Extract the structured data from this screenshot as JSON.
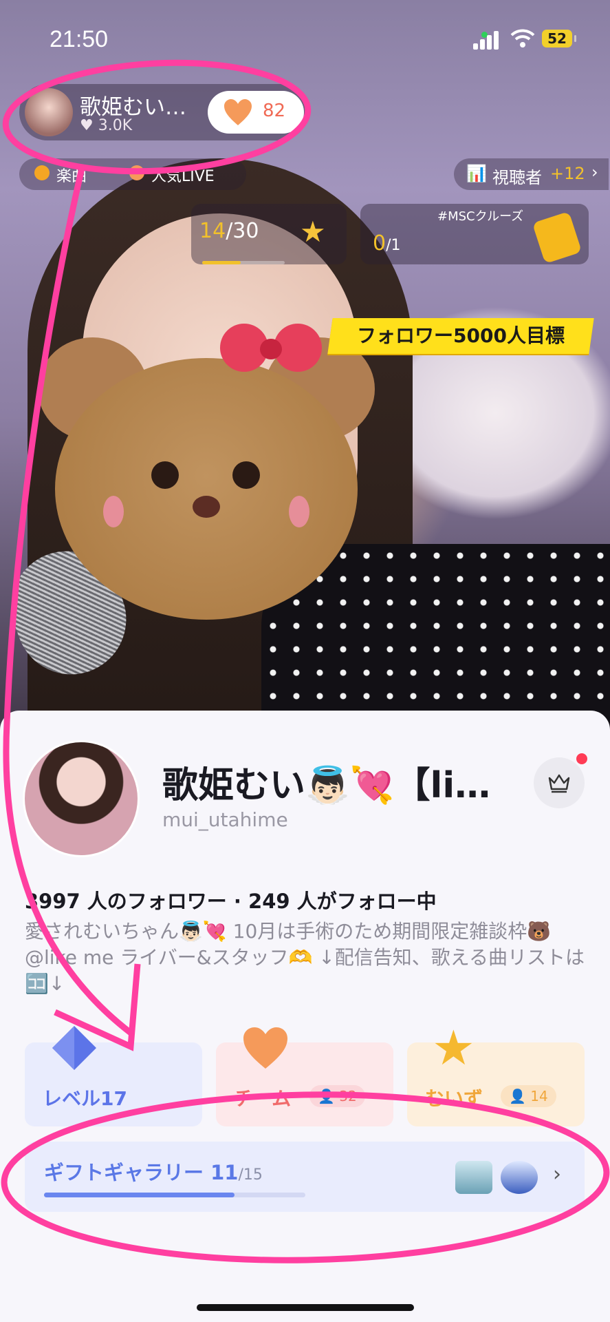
{
  "status_bar": {
    "time": "21:50",
    "battery": "52"
  },
  "stream": {
    "host_name": "歌姫むい…",
    "host_likes": "3.0K",
    "like_count": "82",
    "tag1": "楽曲",
    "tag2": "人気LIVE",
    "viewers_label": "視聴者",
    "viewers_delta": "+12",
    "progress1": {
      "current": "14",
      "total": "/30",
      "fraction": 0.47
    },
    "progress2": {
      "current": "0",
      "total": "/1",
      "tag": "#MSCクルーズ"
    },
    "banner": "フォロワー5000人目標"
  },
  "profile": {
    "name": "歌姫むい👼🏻💘【li…",
    "handle": "mui_utahime",
    "follow_info": "3997 人のフォロワー · 249 人がフォロー中",
    "bio": "愛されむいちゃん👼🏻💘 10月は手術のため期間限定雑談枠🐻 @like me ライバー&スタッフ🫶 ↓配信告知、歌える曲リストは🈁↓",
    "cards": [
      {
        "label": "レベル17",
        "color": "#5c74e8"
      },
      {
        "label": "チーム",
        "count": "32",
        "color": "#f06b6b"
      },
      {
        "label": "むいず",
        "count": "14",
        "color": "#f0a63a"
      }
    ],
    "gift_gallery": {
      "label": "ギフトギャラリー",
      "count": "11",
      "total": "/15",
      "fraction": 0.73
    }
  },
  "colors": {
    "annotation": "#ff3fa0",
    "accent_gold": "#f2c12b"
  }
}
